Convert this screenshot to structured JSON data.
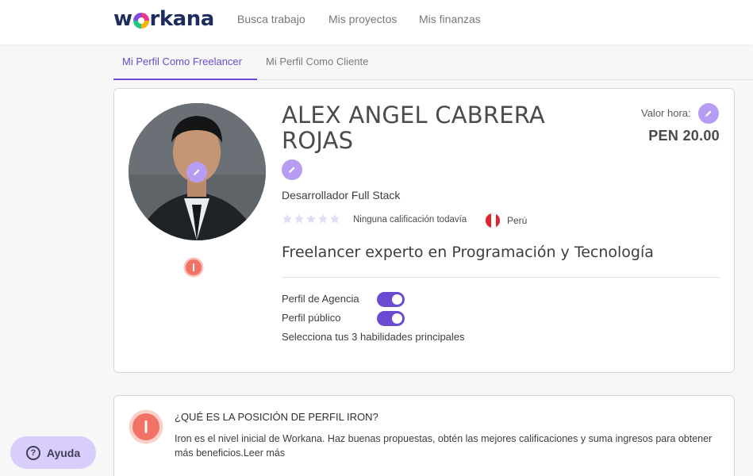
{
  "header": {
    "logo_left": "w",
    "logo_right": "rkana",
    "nav": [
      "Busca trabajo",
      "Mis proyectos",
      "Mis finanzas"
    ]
  },
  "tabs": [
    "Mi Perfil Como Freelancer",
    "Mi Perfil Como Cliente"
  ],
  "profile": {
    "name": "ALEX ANGEL CABRERA ROJAS",
    "role": "Desarrollador Full Stack",
    "rating_text": "Ninguna calificación todavía",
    "country": "Perú",
    "headline": "Freelancer experto en Programación y Tecnología",
    "rate_label": "Valor hora:",
    "rate_value": "PEN 20.00",
    "toggles": [
      {
        "label": "Perfil de Agencia",
        "on": true
      },
      {
        "label": "Perfil público",
        "on": true
      }
    ],
    "skills_note": "Selecciona tus 3 habilidades principales",
    "badge_glyph": "I"
  },
  "iron": {
    "title": "¿QUÉ ES LA POSICIÓN DE PERFIL IRON?",
    "text": "Iron es el nivel inicial de Workana. Haz buenas propuestas, obtén las mejores calificaciones y suma ingresos para obtener más beneficios.",
    "link": "Leer más",
    "badge_glyph": "I"
  },
  "help": {
    "label": "Ayuda",
    "glyph": "?"
  },
  "colors": {
    "accent": "#6a4bd2",
    "edit": "#b69cf2",
    "badge": "#f27366",
    "help_bg": "#d9cdfb"
  }
}
